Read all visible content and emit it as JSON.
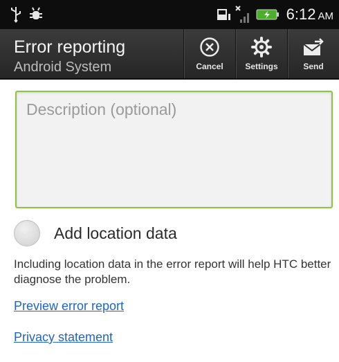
{
  "status_bar": {
    "time": "6:12",
    "ampm": "AM",
    "left_icons": [
      "usb-icon",
      "debug-icon"
    ],
    "right_icons": [
      "sd-card-icon",
      "signal-icon",
      "battery-icon"
    ]
  },
  "action_bar": {
    "title": "Error reporting",
    "subtitle": "Android System",
    "actions": [
      {
        "label": "Cancel",
        "icon": "cancel-icon"
      },
      {
        "label": "Settings",
        "icon": "gear-icon"
      },
      {
        "label": "Send",
        "icon": "send-icon"
      }
    ]
  },
  "form": {
    "description_placeholder": "Description (optional)",
    "description_value": "",
    "location_label": "Add location data",
    "location_checked": false,
    "info_text": "Including location data in the error report will help HTC better diagnose the problem.",
    "preview_link": "Preview error report",
    "privacy_link": "Privacy statement"
  },
  "colors": {
    "accent_border": "#8cc63f",
    "link": "#1e64c8",
    "bar_background": "#2f2f2f"
  }
}
